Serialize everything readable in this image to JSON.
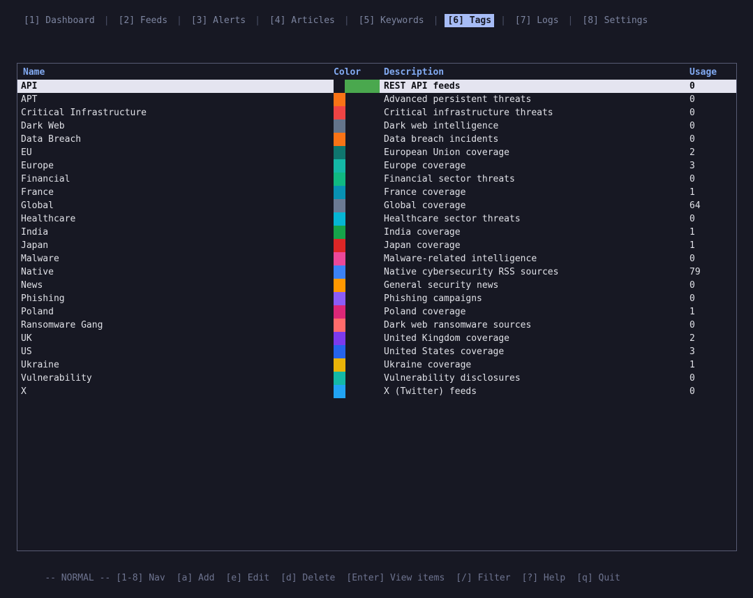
{
  "theme": {
    "background": "#171823",
    "panel_border": "#585c74",
    "text_primary": "#dfe0e6",
    "text_muted": "#7d85a0",
    "text_dim": "#6e7490",
    "header_blue": "#82aaf2",
    "tab_active_bg": "#a7bcf6",
    "tab_active_fg": "#171823",
    "selected_row_bg": "#e4e4f0",
    "selected_row_fg": "#0d0e14",
    "separator": "#4a4f66"
  },
  "tabs": [
    {
      "id": "dashboard",
      "label": "[1] Dashboard",
      "active": false
    },
    {
      "id": "feeds",
      "label": "[2] Feeds",
      "active": false
    },
    {
      "id": "alerts",
      "label": "[3] Alerts",
      "active": false
    },
    {
      "id": "articles",
      "label": "[4] Articles",
      "active": false
    },
    {
      "id": "keywords",
      "label": "[5] Keywords",
      "active": false
    },
    {
      "id": "tags",
      "label": "[6] Tags",
      "active": true
    },
    {
      "id": "logs",
      "label": "[7] Logs",
      "active": false
    },
    {
      "id": "settings",
      "label": "[8] Settings",
      "active": false
    }
  ],
  "table": {
    "columns": [
      "Name",
      "Color",
      "Description",
      "Usage"
    ],
    "selected_index": 0,
    "rows": [
      {
        "name": "API",
        "color": "#4aa84e",
        "description": "REST API feeds",
        "usage": "0"
      },
      {
        "name": "APT",
        "color": "#f97316",
        "description": "Advanced persistent threats",
        "usage": "0"
      },
      {
        "name": "Critical Infrastructure",
        "color": "#ef4444",
        "description": "Critical infrastructure threats",
        "usage": "0"
      },
      {
        "name": "Dark Web",
        "color": "#64748b",
        "description": "Dark web intelligence",
        "usage": "0"
      },
      {
        "name": "Data Breach",
        "color": "#f97316",
        "description": "Data breach incidents",
        "usage": "0"
      },
      {
        "name": "EU",
        "color": "#0f766e",
        "description": "European Union coverage",
        "usage": "2"
      },
      {
        "name": "Europe",
        "color": "#14b8a6",
        "description": "Europe coverage",
        "usage": "3"
      },
      {
        "name": "Financial",
        "color": "#10b981",
        "description": "Financial sector threats",
        "usage": "0"
      },
      {
        "name": "France",
        "color": "#0891b2",
        "description": "France coverage",
        "usage": "1"
      },
      {
        "name": "Global",
        "color": "#6b7a93",
        "description": "Global coverage",
        "usage": "64"
      },
      {
        "name": "Healthcare",
        "color": "#06b6d4",
        "description": "Healthcare sector threats",
        "usage": "0"
      },
      {
        "name": "India",
        "color": "#16a34a",
        "description": "India coverage",
        "usage": "1"
      },
      {
        "name": "Japan",
        "color": "#dc2626",
        "description": "Japan coverage",
        "usage": "1"
      },
      {
        "name": "Malware",
        "color": "#ec4899",
        "description": "Malware-related intelligence",
        "usage": "0"
      },
      {
        "name": "Native",
        "color": "#3b82f6",
        "description": "Native cybersecurity RSS sources",
        "usage": "79"
      },
      {
        "name": "News",
        "color": "#ff9800",
        "description": "General security news",
        "usage": "0"
      },
      {
        "name": "Phishing",
        "color": "#8b5cf6",
        "description": "Phishing campaigns",
        "usage": "0"
      },
      {
        "name": "Poland",
        "color": "#db2777",
        "description": "Poland coverage",
        "usage": "1"
      },
      {
        "name": "Ransomware Gang",
        "color": "#ff6b6b",
        "description": "Dark web ransomware sources",
        "usage": "0"
      },
      {
        "name": "UK",
        "color": "#7c3aed",
        "description": "United Kingdom coverage",
        "usage": "2"
      },
      {
        "name": "US",
        "color": "#2563eb",
        "description": "United States coverage",
        "usage": "3"
      },
      {
        "name": "Ukraine",
        "color": "#eab308",
        "description": "Ukraine coverage",
        "usage": "1"
      },
      {
        "name": "Vulnerability",
        "color": "#14b8a6",
        "description": "Vulnerability disclosures",
        "usage": "0"
      },
      {
        "name": "X",
        "color": "#21a3f3",
        "description": "X (Twitter) feeds",
        "usage": "0"
      }
    ]
  },
  "status_bar": {
    "mode": "-- NORMAL --",
    "hints": [
      "[1-8] Nav",
      "[a] Add",
      "[e] Edit",
      "[d] Delete",
      "[Enter] View items",
      "[/] Filter",
      "[?] Help",
      "[q] Quit"
    ],
    "separator": "|"
  }
}
